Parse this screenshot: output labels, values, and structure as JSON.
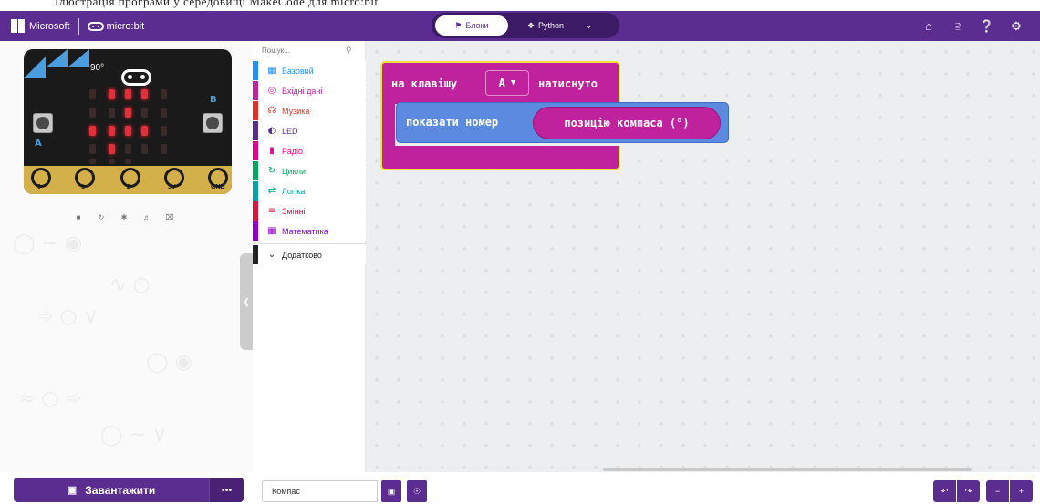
{
  "doc_strip": {
    "text": "Ілюстрація програми у середовищі MakeCode для micro:bit"
  },
  "header": {
    "brand_ms": "Microsoft",
    "brand_mb": "micro:bit",
    "modes": [
      {
        "label": "Блоки",
        "icon": "puzzle-icon",
        "active": true
      },
      {
        "label": "Python",
        "icon": "python-icon",
        "active": false
      }
    ],
    "right_icons": [
      "home-icon",
      "share-icon",
      "help-icon",
      "settings-icon"
    ]
  },
  "simulator": {
    "angle": "90°",
    "button_a": "A",
    "button_b": "B",
    "pins": [
      "0",
      "1",
      "2",
      "3V",
      "GND"
    ],
    "tools": [
      "stop-icon",
      "restart-icon",
      "slowmo-icon",
      "sound-icon",
      "fullscreen-icon"
    ]
  },
  "toolbox": {
    "search_placeholder": "Пошук...",
    "categories": [
      {
        "label": "Базовий",
        "color": "#1e90ff",
        "icon": "grid-icon"
      },
      {
        "label": "Вхідні дані",
        "color": "#c0219d",
        "icon": "target-icon"
      },
      {
        "label": "Музика",
        "color": "#e63022",
        "icon": "headphones-icon"
      },
      {
        "label": "LED",
        "color": "#5c2d91",
        "icon": "toggle-icon"
      },
      {
        "label": "Радіо",
        "color": "#e3008c",
        "icon": "signal-icon"
      },
      {
        "label": "Цикли",
        "color": "#00a65a",
        "icon": "loop-icon"
      },
      {
        "label": "Логіка",
        "color": "#00a4a6",
        "icon": "shuffle-icon"
      },
      {
        "label": "Змінні",
        "color": "#dc143c",
        "icon": "list-icon"
      },
      {
        "label": "Математика",
        "color": "#9400d3",
        "icon": "calculator-icon"
      },
      {
        "label": "Додатково",
        "color": "#222222",
        "icon": "chevron-down-icon"
      }
    ]
  },
  "workspace": {
    "event_block": {
      "label_before": "на клавішу",
      "key": "A",
      "label_after": "натиснуто"
    },
    "show_block": {
      "label": "показати номер",
      "reporter": "позицію компаса (°)"
    }
  },
  "bottom": {
    "download_label": "Завантажити",
    "more_label": "•••",
    "project_name": "Компас"
  },
  "colors": {
    "brand_purple": "#5c2d91",
    "input_block": "#c0219d",
    "basic_block": "#5b8ae0",
    "highlight": "#f3e03a"
  }
}
